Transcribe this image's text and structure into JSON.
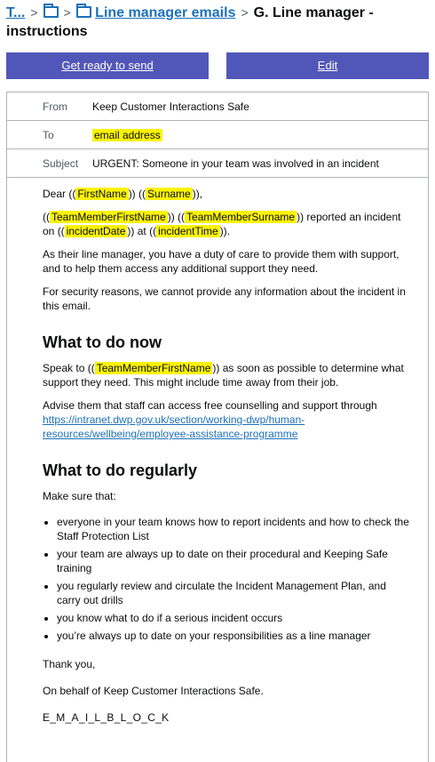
{
  "breadcrumb": {
    "root_label": "T...",
    "folder_label": "Line manager emails",
    "current": "G. Line manager - instructions"
  },
  "actions": {
    "send_label": "Get ready to send",
    "edit_label": "Edit"
  },
  "meta": {
    "from_key": "From",
    "from_value": "Keep Customer Interactions Safe",
    "to_key": "To",
    "to_value": "email address",
    "subject_key": "Subject",
    "subject_value": "URGENT: Someone in your team was involved in an incident"
  },
  "body": {
    "greeting_prefix": "Dear ",
    "greeting_suffix": ",",
    "placeholders": {
      "first_name": "FirstName",
      "surname": "Surname",
      "team_member_first_name": "TeamMemberFirstName",
      "team_member_surname": "TeamMemberSurname",
      "incident_date": "incidentDate",
      "incident_time": "incidentTime"
    },
    "para_reported_mid": " reported an incident on ",
    "para_reported_at": " at ",
    "para_reported_end": ".",
    "para_duty": "As their line manager, you have a duty of care to provide them with support, and to help them access any additional support they need.",
    "para_security": "For security reasons, we cannot provide any information about the incident in this email.",
    "heading_now": "What to do now",
    "speak_prefix": "Speak to ",
    "speak_suffix": " as soon as possible to determine what support they need. This might include time away from their job.",
    "advise_text": "Advise them that staff can access free counselling and support through",
    "advise_link": "https://intranet.dwp.gov.uk/section/working-dwp/human-resources/wellbeing/employee-assistance-programme",
    "heading_regularly": "What to do regularly",
    "make_sure": "Make sure that:",
    "list": [
      "everyone in your team knows how to report incidents and how to check the Staff Protection List",
      "your team are always up to date on their procedural and Keeping Safe training",
      "you regularly review and circulate the Incident Management Plan, and carry out drills",
      "you know what to do if a serious incident occurs",
      "you’re always up to date on your responsibilities as a line manager"
    ],
    "thanks": "Thank you,",
    "on_behalf": "On behalf of Keep Customer Interactions Safe.",
    "email_block": "E_M_A_I_L_B_L_O_C_K"
  },
  "colors": {
    "link": "#1d70b8",
    "button": "#5157b8",
    "highlight": "#fbf305",
    "border": "#b1b4b6"
  }
}
